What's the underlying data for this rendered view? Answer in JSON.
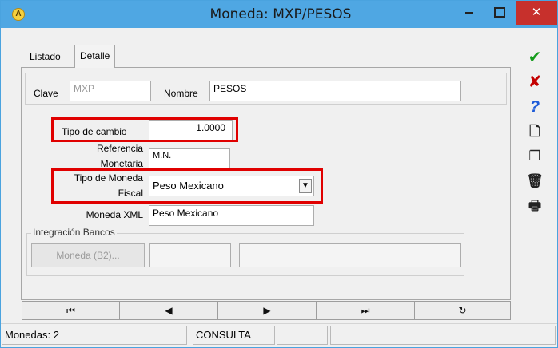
{
  "window": {
    "title": "Moneda: MXP/PESOS",
    "close_glyph": "✕"
  },
  "tabs": [
    {
      "label": "Listado"
    },
    {
      "label": "Detalle"
    }
  ],
  "top_fields": {
    "clave_label": "Clave",
    "clave_value": "MXP",
    "nombre_label": "Nombre",
    "nombre_value": "PESOS"
  },
  "fields": {
    "tipo_cambio_label": "Tipo de cambio",
    "tipo_cambio_value": "1.0000",
    "referencia_label_1": "Referencia",
    "referencia_label_2": "Monetaria",
    "referencia_value": "M.N.",
    "tipo_moneda_label_1": "Tipo de Moneda",
    "tipo_moneda_label_2": "Fiscal",
    "tipo_moneda_value": "Peso Mexicano",
    "moneda_xml_label": "Moneda XML",
    "moneda_xml_value": "Peso Mexicano"
  },
  "integracion": {
    "title": "Integración Bancos",
    "button_label": "Moneda (B2)..."
  },
  "nav": {
    "first": "⏮",
    "prev": "◀",
    "next": "▶",
    "last": "⏭",
    "refresh": "↻"
  },
  "status": {
    "count": "Monedas: 2",
    "mode": "CONSULTA"
  },
  "side_toolbar": {
    "accept": "✔",
    "cancel": "✘",
    "help": "?",
    "new": "🗋",
    "copy": "❐",
    "delete": "🗑",
    "print": "🖶"
  },
  "colors": {
    "titlebar": "#4fa7e3",
    "highlight": "#e00000",
    "accept": "#159c1c",
    "cancel": "#c40000",
    "help": "#1d5bd8"
  }
}
